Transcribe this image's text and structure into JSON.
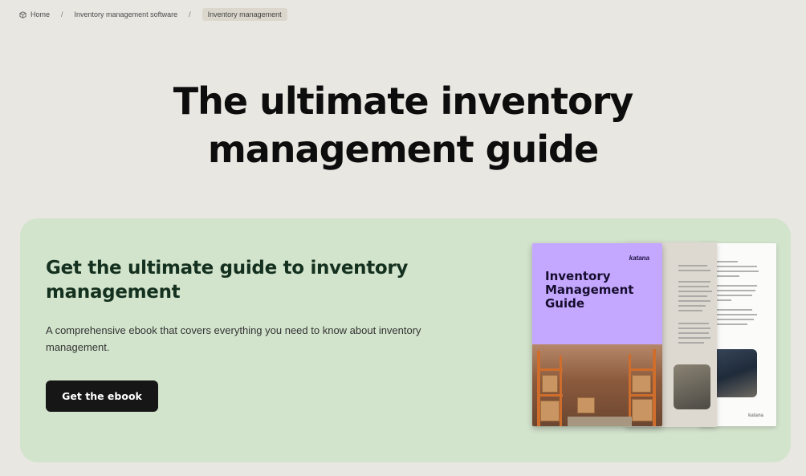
{
  "breadcrumb": {
    "items": [
      {
        "label": "Home",
        "icon": "cube-icon"
      },
      {
        "label": "Inventory management software"
      },
      {
        "label": "Inventory management",
        "current": true
      }
    ],
    "separator": "/"
  },
  "page": {
    "title_line1": "The ultimate inventory",
    "title_line2": "management guide"
  },
  "promo": {
    "heading": "Get the ultimate guide to inventory management",
    "description": "A comprehensive ebook that covers everything you need to know about inventory management.",
    "cta_label": "Get the ebook",
    "colors": {
      "background": "#d3e4cd",
      "heading": "#14301e",
      "button": "#161616"
    }
  },
  "ebook_cover": {
    "brand": "katana",
    "title": "Inventory Management Guide",
    "back_page_brand": "katana",
    "colors": {
      "cover": "#c4a8ff"
    }
  }
}
